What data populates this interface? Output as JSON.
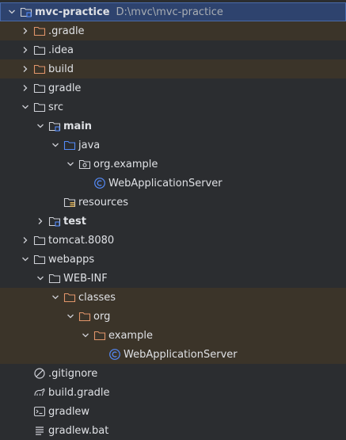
{
  "colors": {
    "folder": "#ced0d6",
    "excluded_folder": "#e0956a",
    "source_folder": "#548af7",
    "class_icon": "#548af7",
    "selected_bg": "#2e436e",
    "excluded_bg": "#3b3429"
  },
  "tree": {
    "root": {
      "name": "mvc-practice",
      "path": "D:\\mvc\\mvc-practice",
      "icon": "module-folder-icon"
    },
    "items": [
      {
        "name": ".gradle",
        "icon": "folder-excluded-icon"
      },
      {
        "name": ".idea",
        "icon": "folder-icon"
      },
      {
        "name": "build",
        "icon": "folder-excluded-icon"
      },
      {
        "name": "gradle",
        "icon": "folder-icon"
      },
      {
        "name": "src",
        "icon": "folder-icon"
      },
      {
        "name": "main",
        "icon": "module-folder-icon"
      },
      {
        "name": "java",
        "icon": "source-folder-icon"
      },
      {
        "name": "org.example",
        "icon": "package-icon"
      },
      {
        "name": "WebApplicationServer",
        "icon": "class-icon"
      },
      {
        "name": "resources",
        "icon": "resources-folder-icon"
      },
      {
        "name": "test",
        "icon": "module-folder-icon"
      },
      {
        "name": "tomcat.8080",
        "icon": "folder-icon"
      },
      {
        "name": "webapps",
        "icon": "folder-icon"
      },
      {
        "name": "WEB-INF",
        "icon": "folder-icon"
      },
      {
        "name": "classes",
        "icon": "folder-excluded-icon"
      },
      {
        "name": "org",
        "icon": "folder-excluded-icon"
      },
      {
        "name": "example",
        "icon": "folder-excluded-icon"
      },
      {
        "name": "WebApplicationServer",
        "icon": "class-icon"
      },
      {
        "name": ".gitignore",
        "icon": "gitignore-icon"
      },
      {
        "name": "build.gradle",
        "icon": "gradle-icon"
      },
      {
        "name": "gradlew",
        "icon": "terminal-file-icon"
      },
      {
        "name": "gradlew.bat",
        "icon": "text-file-icon"
      }
    ]
  }
}
